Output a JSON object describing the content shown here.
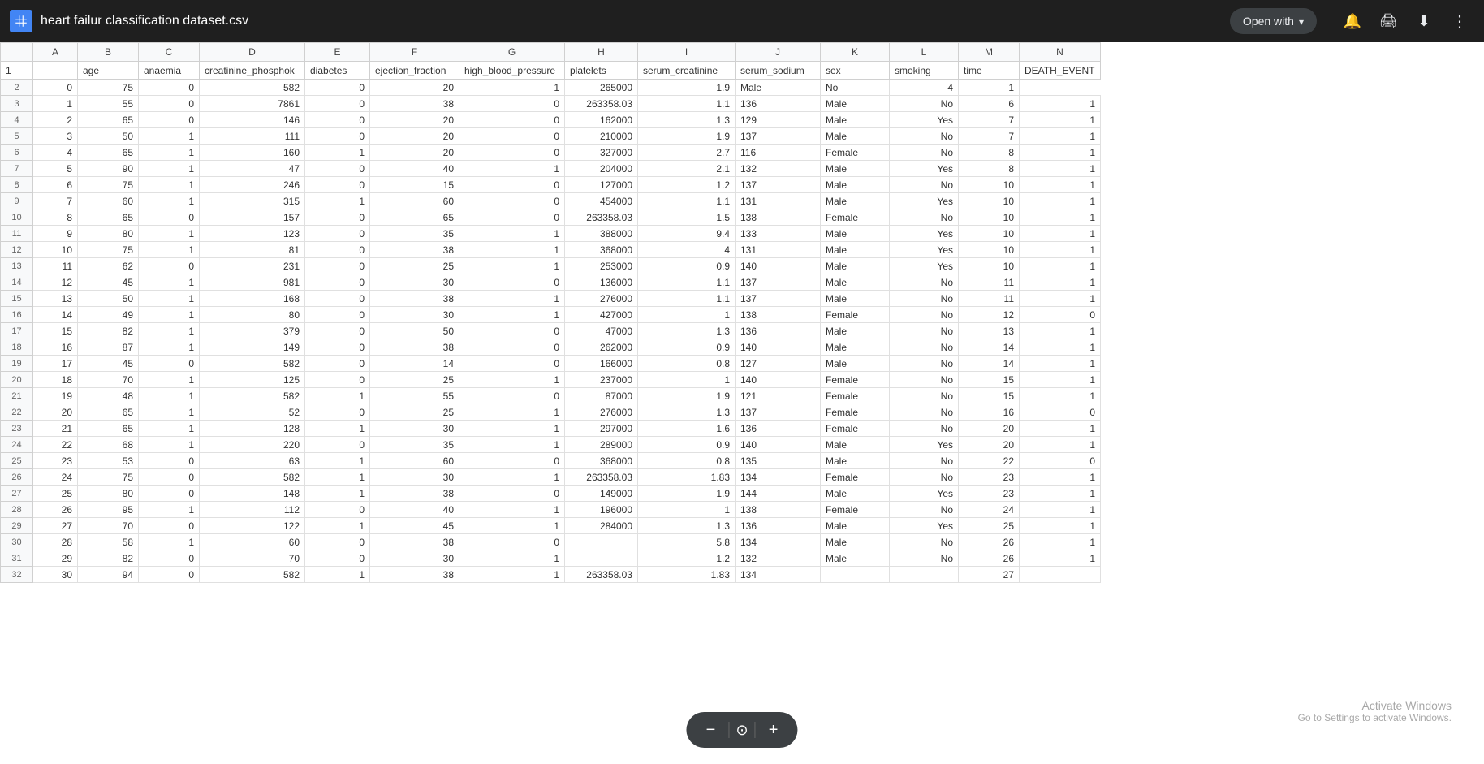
{
  "topbar": {
    "file_icon_color": "#4285f4",
    "file_title": "heart failur classification dataset.csv",
    "open_with_label": "Open with",
    "icons": {
      "notifications": "🔔",
      "print": "🖨",
      "download": "⬇",
      "more": "⋮"
    }
  },
  "spreadsheet": {
    "column_letters": [
      "A",
      "B",
      "C",
      "D",
      "E",
      "F",
      "G",
      "H",
      "I",
      "J",
      "K",
      "L",
      "M",
      "N"
    ],
    "column_headers": [
      "age",
      "anaemia",
      "creatinine_phosphok",
      "diabetes",
      "ejection_fraction",
      "high_blood_pressure",
      "platelets",
      "serum_creatinine",
      "serum_sodium",
      "sex",
      "smoking",
      "time",
      "DEATH_EVENT"
    ],
    "rows": [
      [
        "0",
        "75",
        "0",
        "582",
        "0",
        "20",
        "1",
        "265000",
        "1.9",
        "Male",
        "No",
        "4",
        "1"
      ],
      [
        "1",
        "55",
        "0",
        "7861",
        "0",
        "38",
        "0",
        "263358.03",
        "1.1",
        "136",
        "Male",
        "No",
        "6",
        "1"
      ],
      [
        "2",
        "65",
        "0",
        "146",
        "0",
        "20",
        "0",
        "162000",
        "1.3",
        "129",
        "Male",
        "Yes",
        "7",
        "1"
      ],
      [
        "3",
        "50",
        "1",
        "111",
        "0",
        "20",
        "0",
        "210000",
        "1.9",
        "137",
        "Male",
        "No",
        "7",
        "1"
      ],
      [
        "4",
        "65",
        "1",
        "160",
        "1",
        "20",
        "0",
        "327000",
        "2.7",
        "116",
        "Female",
        "No",
        "8",
        "1"
      ],
      [
        "5",
        "90",
        "1",
        "47",
        "0",
        "40",
        "1",
        "204000",
        "2.1",
        "132",
        "Male",
        "Yes",
        "8",
        "1"
      ],
      [
        "6",
        "75",
        "1",
        "246",
        "0",
        "15",
        "0",
        "127000",
        "1.2",
        "137",
        "Male",
        "No",
        "10",
        "1"
      ],
      [
        "7",
        "60",
        "1",
        "315",
        "1",
        "60",
        "0",
        "454000",
        "1.1",
        "131",
        "Male",
        "Yes",
        "10",
        "1"
      ],
      [
        "8",
        "65",
        "0",
        "157",
        "0",
        "65",
        "0",
        "263358.03",
        "1.5",
        "138",
        "Female",
        "No",
        "10",
        "1"
      ],
      [
        "9",
        "80",
        "1",
        "123",
        "0",
        "35",
        "1",
        "388000",
        "9.4",
        "133",
        "Male",
        "Yes",
        "10",
        "1"
      ],
      [
        "10",
        "75",
        "1",
        "81",
        "0",
        "38",
        "1",
        "368000",
        "4",
        "131",
        "Male",
        "Yes",
        "10",
        "1"
      ],
      [
        "11",
        "62",
        "0",
        "231",
        "0",
        "25",
        "1",
        "253000",
        "0.9",
        "140",
        "Male",
        "Yes",
        "10",
        "1"
      ],
      [
        "12",
        "45",
        "1",
        "981",
        "0",
        "30",
        "0",
        "136000",
        "1.1",
        "137",
        "Male",
        "No",
        "11",
        "1"
      ],
      [
        "13",
        "50",
        "1",
        "168",
        "0",
        "38",
        "1",
        "276000",
        "1.1",
        "137",
        "Male",
        "No",
        "11",
        "1"
      ],
      [
        "14",
        "49",
        "1",
        "80",
        "0",
        "30",
        "1",
        "427000",
        "1",
        "138",
        "Female",
        "No",
        "12",
        "0"
      ],
      [
        "15",
        "82",
        "1",
        "379",
        "0",
        "50",
        "0",
        "47000",
        "1.3",
        "136",
        "Male",
        "No",
        "13",
        "1"
      ],
      [
        "16",
        "87",
        "1",
        "149",
        "0",
        "38",
        "0",
        "262000",
        "0.9",
        "140",
        "Male",
        "No",
        "14",
        "1"
      ],
      [
        "17",
        "45",
        "0",
        "582",
        "0",
        "14",
        "0",
        "166000",
        "0.8",
        "127",
        "Male",
        "No",
        "14",
        "1"
      ],
      [
        "18",
        "70",
        "1",
        "125",
        "0",
        "25",
        "1",
        "237000",
        "1",
        "140",
        "Female",
        "No",
        "15",
        "1"
      ],
      [
        "19",
        "48",
        "1",
        "582",
        "1",
        "55",
        "0",
        "87000",
        "1.9",
        "121",
        "Female",
        "No",
        "15",
        "1"
      ],
      [
        "20",
        "65",
        "1",
        "52",
        "0",
        "25",
        "1",
        "276000",
        "1.3",
        "137",
        "Female",
        "No",
        "16",
        "0"
      ],
      [
        "21",
        "65",
        "1",
        "128",
        "1",
        "30",
        "1",
        "297000",
        "1.6",
        "136",
        "Female",
        "No",
        "20",
        "1"
      ],
      [
        "22",
        "68",
        "1",
        "220",
        "0",
        "35",
        "1",
        "289000",
        "0.9",
        "140",
        "Male",
        "Yes",
        "20",
        "1"
      ],
      [
        "23",
        "53",
        "0",
        "63",
        "1",
        "60",
        "0",
        "368000",
        "0.8",
        "135",
        "Male",
        "No",
        "22",
        "0"
      ],
      [
        "24",
        "75",
        "0",
        "582",
        "1",
        "30",
        "1",
        "263358.03",
        "1.83",
        "134",
        "Female",
        "No",
        "23",
        "1"
      ],
      [
        "25",
        "80",
        "0",
        "148",
        "1",
        "38",
        "0",
        "149000",
        "1.9",
        "144",
        "Male",
        "Yes",
        "23",
        "1"
      ],
      [
        "26",
        "95",
        "1",
        "112",
        "0",
        "40",
        "1",
        "196000",
        "1",
        "138",
        "Female",
        "No",
        "24",
        "1"
      ],
      [
        "27",
        "70",
        "0",
        "122",
        "1",
        "45",
        "1",
        "284000",
        "1.3",
        "136",
        "Male",
        "Yes",
        "25",
        "1"
      ],
      [
        "28",
        "58",
        "1",
        "60",
        "0",
        "38",
        "0",
        "",
        "5.8",
        "134",
        "Male",
        "No",
        "26",
        "1"
      ],
      [
        "29",
        "82",
        "0",
        "70",
        "0",
        "30",
        "1",
        "",
        "1.2",
        "132",
        "Male",
        "No",
        "26",
        "1"
      ],
      [
        "30",
        "94",
        "0",
        "582",
        "1",
        "38",
        "1",
        "263358.03",
        "1.83",
        "134",
        "",
        "",
        "27",
        ""
      ]
    ]
  },
  "zoom_toolbar": {
    "minus_label": "−",
    "zoom_icon": "⊙",
    "plus_label": "+"
  },
  "activate_windows": {
    "title": "Activate Windows",
    "subtitle": "Go to Settings to activate Windows."
  }
}
